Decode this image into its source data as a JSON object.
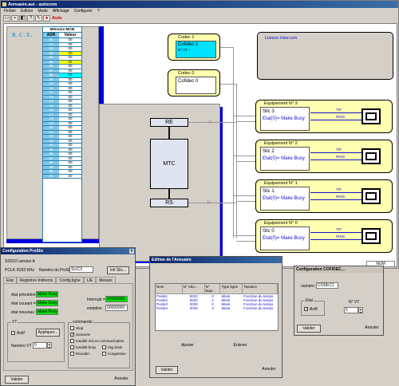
{
  "app": {
    "title": "Annuaire.aut - autocom",
    "menu": [
      "Fichier",
      "Edition",
      "Mode",
      "Affichage",
      "Configurer",
      "?"
    ],
    "auto_label": "Auto"
  },
  "rcx": {
    "label": "R.C.X.",
    "table_title": "Mémoire MCM",
    "col_adr": "ADR",
    "col_val": "Valeur",
    "rows": [
      {
        "a": "00",
        "v": "00",
        "c": "#ffffff"
      },
      {
        "a": "01",
        "v": "00",
        "c": "#ffffff"
      },
      {
        "a": "02",
        "v": "00",
        "c": "#ffffff"
      },
      {
        "a": "03",
        "v": "00",
        "c": "#ffff00"
      },
      {
        "a": "04",
        "v": "00",
        "c": "#ffffff"
      },
      {
        "a": "05",
        "v": "02",
        "c": "#ffff00"
      },
      {
        "a": "06",
        "v": "00",
        "c": "#ffffff"
      },
      {
        "a": "07",
        "v": "00",
        "c": "#ffffff"
      },
      {
        "a": "08",
        "v": "03",
        "c": "#00ffff"
      },
      {
        "a": "09",
        "v": "00",
        "c": "#ffffff"
      },
      {
        "a": "10",
        "v": "00",
        "c": "#ffffff"
      },
      {
        "a": "11",
        "v": "00",
        "c": "#ffffff"
      },
      {
        "a": "12",
        "v": "00",
        "c": "#ffffff"
      },
      {
        "a": "13",
        "v": "00",
        "c": "#ffffff"
      },
      {
        "a": "14",
        "v": "00",
        "c": "#ffffff"
      },
      {
        "a": "15",
        "v": "00",
        "c": "#ffffff"
      },
      {
        "a": "16",
        "v": "00",
        "c": "#ffffff"
      },
      {
        "a": "17",
        "v": "00",
        "c": "#ffffff"
      },
      {
        "a": "18",
        "v": "00",
        "c": "#ffffff"
      },
      {
        "a": "19",
        "v": "00",
        "c": "#ffffff"
      },
      {
        "a": "20",
        "v": "00",
        "c": "#ffffff"
      },
      {
        "a": "21",
        "v": "00",
        "c": "#ffffff"
      },
      {
        "a": "22",
        "v": "00",
        "c": "#ffffff"
      },
      {
        "a": "23",
        "v": "00",
        "c": "#ffffff"
      },
      {
        "a": "24",
        "v": "00",
        "c": "#ffffff"
      },
      {
        "a": "25",
        "v": "00",
        "c": "#ffffff"
      },
      {
        "a": "26",
        "v": "00",
        "c": "#ffffff"
      },
      {
        "a": "27",
        "v": "00",
        "c": "#ffffff"
      },
      {
        "a": "28",
        "v": "00",
        "c": "#ffffff"
      },
      {
        "a": "29",
        "v": "00",
        "c": "#ffffff"
      },
      {
        "a": "30",
        "v": "00",
        "c": "#ffffff"
      },
      {
        "a": "31",
        "v": "00",
        "c": "#ffffff"
      }
    ]
  },
  "codec1": {
    "title": "Codec 1",
    "label": "Cofidec 1",
    "sub": "N° VT -"
  },
  "codec0": {
    "title": "Codec 0",
    "label": "Cofidec 0"
  },
  "liaison": "Liaison Intercom",
  "mtc": {
    "re": "RE",
    "mtc": "MTC",
    "rs": "RS"
  },
  "equip": [
    {
      "title": "Equipement N° 3",
      "slic": "Slic 3",
      "etat": "Etat(0)= Make Busy"
    },
    {
      "title": "Equipement N° 2",
      "slic": "Slic 2",
      "etat": "Etat(0)= Make Busy"
    },
    {
      "title": "Equipement N° 1",
      "slic": "Slic 1",
      "etat": "Etat(0)= Make Busy"
    },
    {
      "title": "Equipement N° 0",
      "slic": "Slic 0",
      "etat": "Etat(0)= Make Busy"
    }
  ],
  "tip": "TIP",
  "ring": "RING",
  "status": "NUM",
  "proslic": {
    "title": "Configuration ProSlic",
    "version": "SI3210 version A",
    "pclk_label": "PCLK",
    "pclk": "8192 KHz",
    "num_label": "Numéro du ProSlic",
    "num": "SLIC3",
    "init": "Init Slic...",
    "tabs": [
      "Etat",
      "Registres Indirects",
      "Config ligne",
      "L/E",
      "Mesure"
    ],
    "prev_label": "état précédent =",
    "prev": "Make Busy",
    "cur_label": "état courant =",
    "cur": "Make Busy",
    "new_label": "état nouveau =",
    "new": "Make Busy",
    "interrupt_label": "Interrupt =",
    "interrupt": "00000000",
    "exception_label": "exeption",
    "exception": "00000000",
    "vt_title": "VT",
    "actif": "Actif",
    "appliquer": "Appliquer...",
    "numvt_label": "Numéro VT =",
    "numvt": "0",
    "cmd_title": "commande",
    "cmds": [
      "Stop",
      "Sonnerie",
      "tonalité mis en communication",
      "tonalité busy",
      "ring back",
      "Recoder",
      "Congestion"
    ],
    "valider": "Valider",
    "annuler": "Annuler"
  },
  "annuaire": {
    "title": "Edition de l'Annuaire",
    "headers": [
      "Nom",
      "N° Abo...",
      "N° équi...",
      "Type ligne",
      "Taxation"
    ],
    "rows": [
      [
        "Poste1",
        "0010",
        "0",
        "Mixte",
        "Fonction du temps"
      ],
      [
        "Poste2",
        "0020",
        "1",
        "Mixte",
        "Fonction du temps"
      ],
      [
        "Poste3",
        "0030",
        "2",
        "Mixte",
        "Fonction du temps"
      ],
      [
        "Poste4",
        "0040",
        "3",
        "Mixte",
        "Fonction du temps"
      ]
    ],
    "ajouter": "Ajouter",
    "enlever": "Enlever",
    "valider": "Valider",
    "annuler": "Annuler"
  },
  "cofidec": {
    "title": "Configuration COFIDEC...",
    "numero_label": "numéro =",
    "numero": "CODEC1",
    "etat_title": "Etat",
    "actif": "Actif",
    "nvt_label": "N° VT",
    "nvt": "5",
    "valider": "Valider",
    "annuler": "Annuler"
  }
}
